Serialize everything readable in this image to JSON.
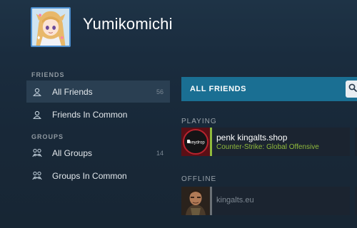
{
  "profile": {
    "username": "Yumikomichi",
    "avatar_icon": "anime-avatar"
  },
  "sidebar": {
    "friends_section": "FRIENDS",
    "groups_section": "GROUPS",
    "items": [
      {
        "label": "All Friends",
        "count": "56",
        "icon": "person-icon",
        "active": true
      },
      {
        "label": "Friends In Common",
        "count": "",
        "icon": "person-icon",
        "active": false
      },
      {
        "label": "All Groups",
        "count": "14",
        "icon": "group-icon",
        "active": false
      },
      {
        "label": "Groups In Common",
        "count": "",
        "icon": "group-icon",
        "active": false
      }
    ]
  },
  "main": {
    "header_title": "ALL FRIENDS",
    "search_icon": "search-icon",
    "playing_label": "PLAYING",
    "offline_label": "OFFLINE",
    "friends": [
      {
        "name": "penk kingalts.shop",
        "game": "Counter-Strike: Global Offensive",
        "status": "in-game",
        "avatar_text": "keydrop"
      },
      {
        "name": "kingalts.eu",
        "game": "",
        "status": "offline"
      }
    ]
  },
  "colors": {
    "accent": "#1a6f93",
    "in_game": "#90ba3c",
    "offline": "#6b7177",
    "background": "#1b2d3f"
  }
}
